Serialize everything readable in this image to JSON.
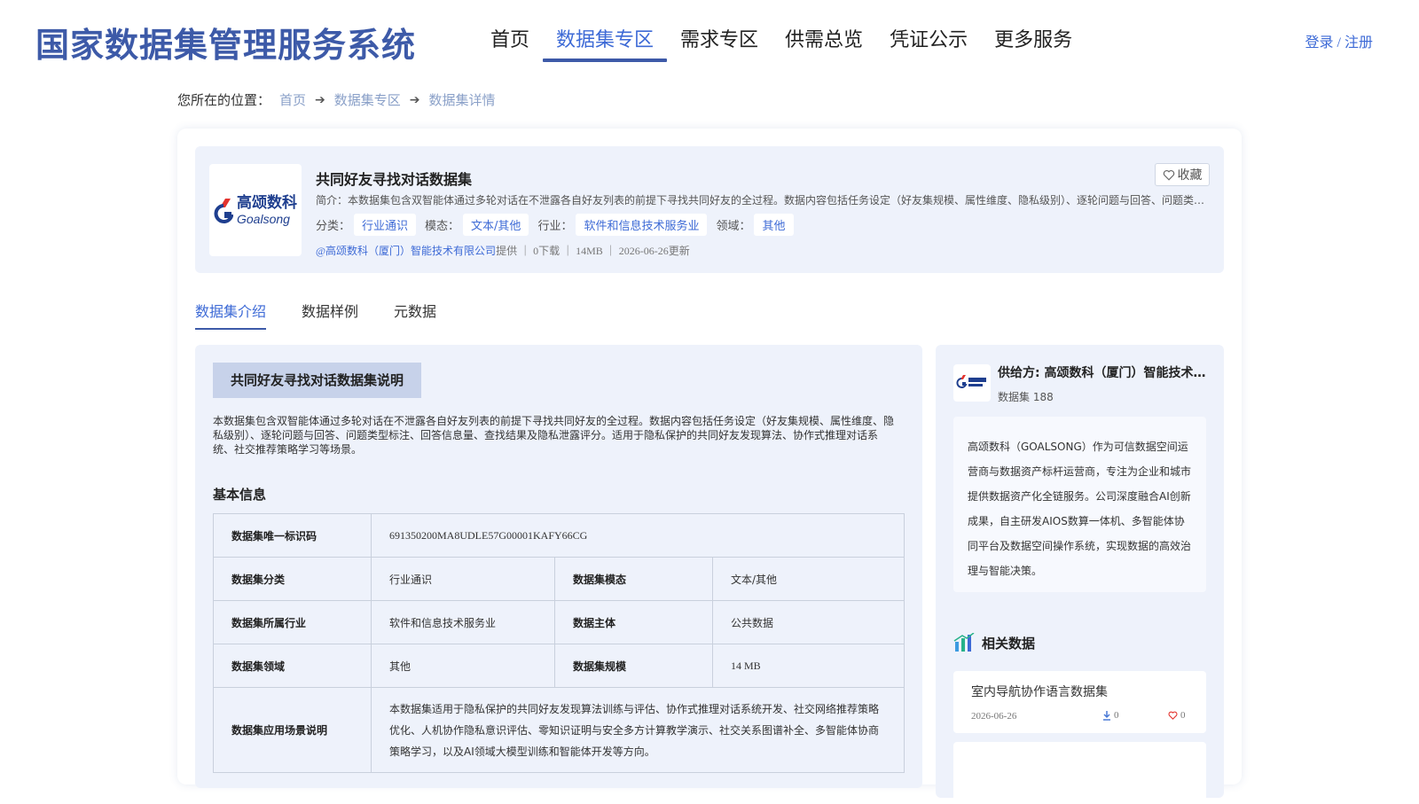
{
  "header": {
    "site_title": "国家数据集管理服务系统",
    "nav": [
      "首页",
      "数据集专区",
      "需求专区",
      "供需总览",
      "凭证公示",
      "更多服务"
    ],
    "auth": "登录 / 注册"
  },
  "breadcrumb": {
    "label": "您所在的位置：",
    "items": [
      "首页",
      "数据集专区",
      "数据集详情"
    ]
  },
  "dataset": {
    "title": "共同好友寻找对话数据集",
    "intro": "简介：本数据集包含双智能体通过多轮对话在不泄露各自好友列表的前提下寻找共同好友的全过程。数据内容包括任务设定（好友集规模、属性维度、隐私级别）、逐轮问题与回答、问题类型标注、回答信息量、查找结果及隐私泄露评分。适用于隐私保护的共同好友发现算法、协作式推理对话系统、社交推荐策略学习等场景。",
    "tags": [
      {
        "label": "分类：",
        "value": "行业通识"
      },
      {
        "label": "模态：",
        "value": "文本/其他"
      },
      {
        "label": "行业：",
        "value": "软件和信息技术服务业"
      },
      {
        "label": "领域：",
        "value": "其他"
      }
    ],
    "provider": "@高颂数科（厦门）智能技术有限公司",
    "meta_rest": "提供 ｜ 0下载 ｜ 14MB ｜ 2026-06-26更新",
    "fav_label": "收藏",
    "logo_cn": "高颂数科",
    "logo_en": "Goalsong"
  },
  "tabs": [
    "数据集介绍",
    "数据样例",
    "元数据"
  ],
  "intro_section": {
    "heading": "共同好友寻找对话数据集说明",
    "description": "本数据集包含双智能体通过多轮对话在不泄露各自好友列表的前提下寻找共同好友的全过程。数据内容包括任务设定（好友集规模、属性维度、隐私级别）、逐轮问题与回答、问题类型标注、回答信息量、查找结果及隐私泄露评分。适用于隐私保护的共同好友发现算法、协作式推理对话系统、社交推荐策略学习等场景。",
    "basic_title": "基本信息"
  },
  "basic_info": {
    "id_key": "数据集唯一标识码",
    "id_val": "691350200MA8UDLE57G00001KAFY66CG",
    "rows": [
      {
        "k1": "数据集分类",
        "v1": "行业通识",
        "k2": "数据集模态",
        "v2": "文本/其他"
      },
      {
        "k1": "数据集所属行业",
        "v1": "软件和信息技术服务业",
        "k2": "数据主体",
        "v2": "公共数据"
      },
      {
        "k1": "数据集领域",
        "v1": "其他",
        "k2": "数据集规模",
        "v2": "14 MB"
      }
    ],
    "scene_key": "数据集应用场景说明",
    "scene_val": "本数据集适用于隐私保护的共同好友发现算法训练与评估、协作式推理对话系统开发、社交网络推荐策略优化、人机协作隐私意识评估、零知识证明与安全多方计算教学演示、社交关系图谱补全、多智能体协商策略学习，以及AI领域大模型训练和智能体开发等方向。"
  },
  "provider_card": {
    "name": "供给方: 高颂数科（厦门）智能技术有限公司",
    "count": "数据集 188",
    "desc": "高颂数科（GOALSONG）作为可信数据空间运营商与数据资产标杆运营商，专注为企业和城市提供数据资产化全链服务。公司深度融合AI创新成果，自主研发AIOS数算一体机、多智能体协同平台及数据空间操作系统，实现数据的高效治理与智能决策。"
  },
  "related": {
    "heading": "相关数据",
    "items": [
      {
        "title": "室内导航协作语言数据集",
        "date": "2026-06-26",
        "downloads": "0",
        "likes": "0"
      }
    ]
  },
  "colors": {
    "brand": "#3d5aa8",
    "accent": "#3d6ad6",
    "panel": "#eef2fb",
    "logo_red": "#e3342f"
  }
}
